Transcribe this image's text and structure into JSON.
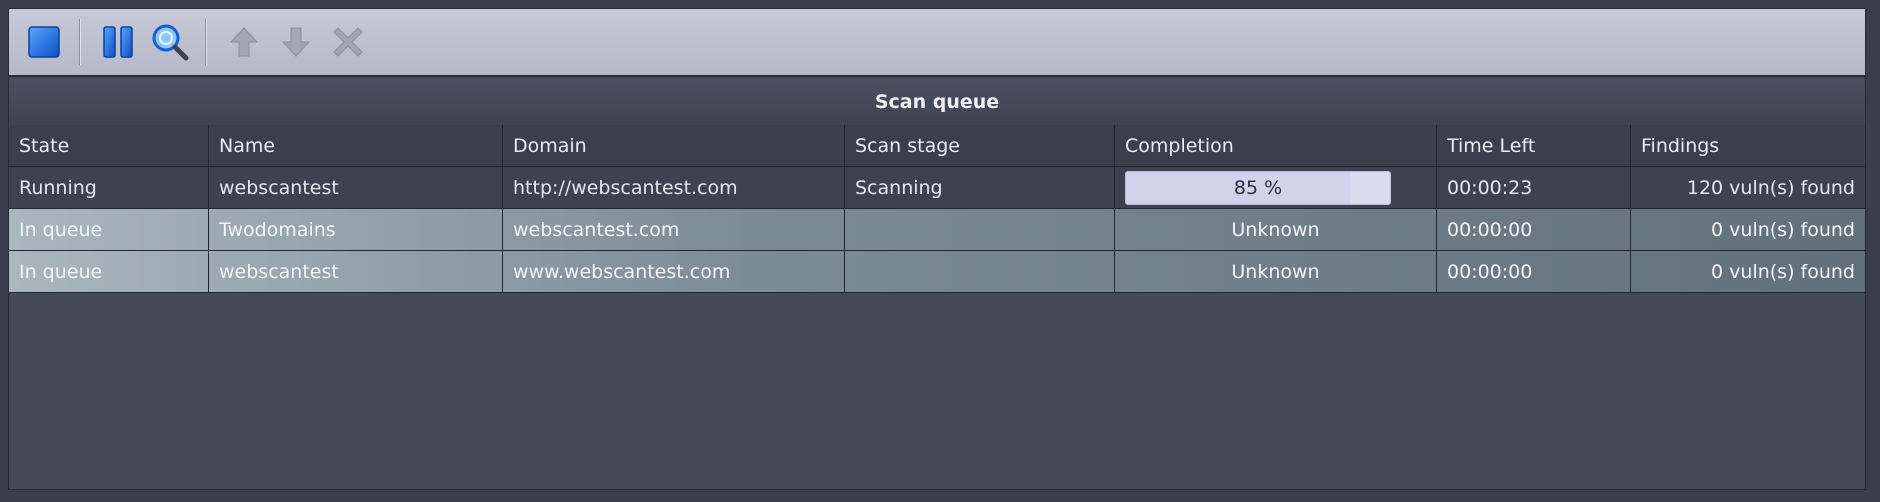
{
  "toolbar": {
    "buttons": [
      {
        "icon": "stop-icon",
        "enabled": true
      },
      {
        "icon": "pause-icon",
        "enabled": true
      },
      {
        "icon": "magnifier-icon",
        "enabled": true
      },
      {
        "icon": "arrow-up-icon",
        "enabled": false
      },
      {
        "icon": "arrow-down-icon",
        "enabled": false
      },
      {
        "icon": "delete-icon",
        "enabled": false
      }
    ]
  },
  "panel": {
    "title": "Scan queue"
  },
  "table": {
    "headers": [
      "State",
      "Name",
      "Domain",
      "Scan stage",
      "Completion",
      "Time Left",
      "Findings"
    ],
    "rows": [
      {
        "state": "Running",
        "name": "webscantest",
        "domain": "http://webscantest.com",
        "stage": "Scanning",
        "completion": "85 %",
        "progress": 0.85,
        "time_left": "00:00:23",
        "findings": "120 vuln(s) found"
      },
      {
        "state": "In queue",
        "name": "Twodomains",
        "domain": "webscantest.com",
        "stage": "",
        "completion": "Unknown",
        "time_left": "00:00:00",
        "findings": "0 vuln(s) found"
      },
      {
        "state": "In queue",
        "name": "webscantest",
        "domain": "www.webscantest.com",
        "stage": "",
        "completion": "Unknown",
        "time_left": "00:00:00",
        "findings": "0 vuln(s) found"
      }
    ]
  },
  "colors": {
    "toolbar_bg": "#bfc2d1",
    "panel_bg": "#454a59",
    "queued_row_start": "#a9b6be",
    "queued_row_end": "#617079",
    "progress_bg": "#d8dcef",
    "icon_blue": "#1e6fe0"
  }
}
